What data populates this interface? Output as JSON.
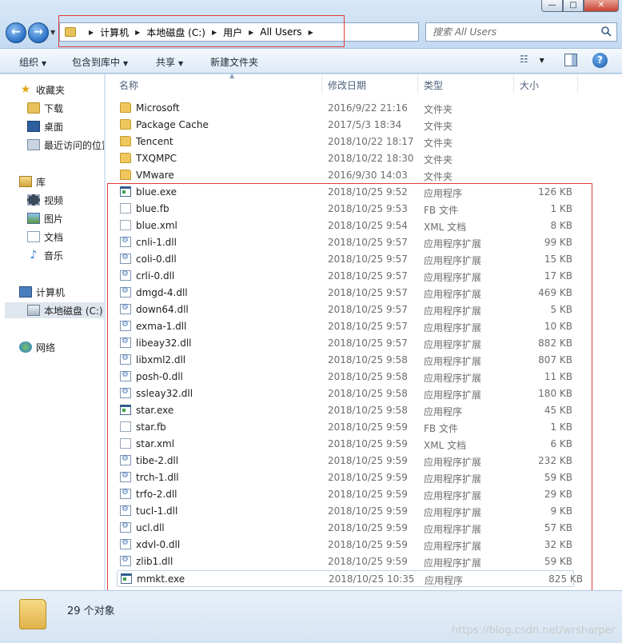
{
  "window": {
    "minimize_glyph": "—",
    "maximize_glyph": "□",
    "close_glyph": "✕"
  },
  "address": {
    "crumbs": [
      "计算机",
      "本地磁盘 (C:)",
      "用户",
      "All Users"
    ],
    "search_placeholder": "搜索 All Users"
  },
  "toolbar": {
    "organize": "组织",
    "include_in_library": "包含到库中",
    "share": "共享",
    "new_folder": "新建文件夹"
  },
  "sidebar": {
    "favorites": "收藏夹",
    "downloads": "下载",
    "desktop": "桌面",
    "recent": "最近访问的位置",
    "libraries": "库",
    "videos": "视频",
    "pictures": "图片",
    "documents": "文档",
    "music": "音乐",
    "computer": "计算机",
    "local_disk": "本地磁盘 (C:)",
    "network": "网络"
  },
  "columns": {
    "name": "名称",
    "date": "修改日期",
    "type": "类型",
    "size": "大小"
  },
  "files": [
    {
      "icon": "folder-icon",
      "name": "Microsoft",
      "date": "2016/9/22 21:16",
      "type": "文件夹",
      "size": ""
    },
    {
      "icon": "folder-icon",
      "name": "Package Cache",
      "date": "2017/5/3 18:34",
      "type": "文件夹",
      "size": ""
    },
    {
      "icon": "folder-icon",
      "name": "Tencent",
      "date": "2018/10/22 18:17",
      "type": "文件夹",
      "size": ""
    },
    {
      "icon": "folder-icon",
      "name": "TXQMPC",
      "date": "2018/10/22 18:30",
      "type": "文件夹",
      "size": ""
    },
    {
      "icon": "folder-icon",
      "name": "VMware",
      "date": "2016/9/30 14:03",
      "type": "文件夹",
      "size": ""
    },
    {
      "icon": "exe-icon",
      "name": "blue.exe",
      "date": "2018/10/25 9:52",
      "type": "应用程序",
      "size": "126 KB"
    },
    {
      "icon": "file-icon",
      "name": "blue.fb",
      "date": "2018/10/25 9:53",
      "type": "FB 文件",
      "size": "1 KB"
    },
    {
      "icon": "file-icon",
      "name": "blue.xml",
      "date": "2018/10/25 9:54",
      "type": "XML 文档",
      "size": "8 KB"
    },
    {
      "icon": "dll-icon",
      "name": "cnli-1.dll",
      "date": "2018/10/25 9:57",
      "type": "应用程序扩展",
      "size": "99 KB"
    },
    {
      "icon": "dll-icon",
      "name": "coli-0.dll",
      "date": "2018/10/25 9:57",
      "type": "应用程序扩展",
      "size": "15 KB"
    },
    {
      "icon": "dll-icon",
      "name": "crli-0.dll",
      "date": "2018/10/25 9:57",
      "type": "应用程序扩展",
      "size": "17 KB"
    },
    {
      "icon": "dll-icon",
      "name": "dmgd-4.dll",
      "date": "2018/10/25 9:57",
      "type": "应用程序扩展",
      "size": "469 KB"
    },
    {
      "icon": "dll-icon",
      "name": "down64.dll",
      "date": "2018/10/25 9:57",
      "type": "应用程序扩展",
      "size": "5 KB"
    },
    {
      "icon": "dll-icon",
      "name": "exma-1.dll",
      "date": "2018/10/25 9:57",
      "type": "应用程序扩展",
      "size": "10 KB"
    },
    {
      "icon": "dll-icon",
      "name": "libeay32.dll",
      "date": "2018/10/25 9:57",
      "type": "应用程序扩展",
      "size": "882 KB"
    },
    {
      "icon": "dll-icon",
      "name": "libxml2.dll",
      "date": "2018/10/25 9:58",
      "type": "应用程序扩展",
      "size": "807 KB"
    },
    {
      "icon": "dll-icon",
      "name": "posh-0.dll",
      "date": "2018/10/25 9:58",
      "type": "应用程序扩展",
      "size": "11 KB"
    },
    {
      "icon": "dll-icon",
      "name": "ssleay32.dll",
      "date": "2018/10/25 9:58",
      "type": "应用程序扩展",
      "size": "180 KB"
    },
    {
      "icon": "exe-icon",
      "name": "star.exe",
      "date": "2018/10/25 9:58",
      "type": "应用程序",
      "size": "45 KB"
    },
    {
      "icon": "file-icon",
      "name": "star.fb",
      "date": "2018/10/25 9:59",
      "type": "FB 文件",
      "size": "1 KB"
    },
    {
      "icon": "file-icon",
      "name": "star.xml",
      "date": "2018/10/25 9:59",
      "type": "XML 文档",
      "size": "6 KB"
    },
    {
      "icon": "dll-icon",
      "name": "tibe-2.dll",
      "date": "2018/10/25 9:59",
      "type": "应用程序扩展",
      "size": "232 KB"
    },
    {
      "icon": "dll-icon",
      "name": "trch-1.dll",
      "date": "2018/10/25 9:59",
      "type": "应用程序扩展",
      "size": "59 KB"
    },
    {
      "icon": "dll-icon",
      "name": "trfo-2.dll",
      "date": "2018/10/25 9:59",
      "type": "应用程序扩展",
      "size": "29 KB"
    },
    {
      "icon": "dll-icon",
      "name": "tucl-1.dll",
      "date": "2018/10/25 9:59",
      "type": "应用程序扩展",
      "size": "9 KB"
    },
    {
      "icon": "dll-icon",
      "name": "ucl.dll",
      "date": "2018/10/25 9:59",
      "type": "应用程序扩展",
      "size": "57 KB"
    },
    {
      "icon": "dll-icon",
      "name": "xdvl-0.dll",
      "date": "2018/10/25 9:59",
      "type": "应用程序扩展",
      "size": "32 KB"
    },
    {
      "icon": "dll-icon",
      "name": "zlib1.dll",
      "date": "2018/10/25 9:59",
      "type": "应用程序扩展",
      "size": "59 KB"
    },
    {
      "icon": "exe-icon",
      "name": "mmkt.exe",
      "date": "2018/10/25 10:35",
      "type": "应用程序",
      "size": "825 KB"
    }
  ],
  "status": {
    "count": "29 个对象"
  },
  "watermark": "https://blog.csdn.net/wrsharper",
  "colors": {
    "highlight_box": "#e23b3b",
    "window_chrome": "#cfe2f5"
  }
}
